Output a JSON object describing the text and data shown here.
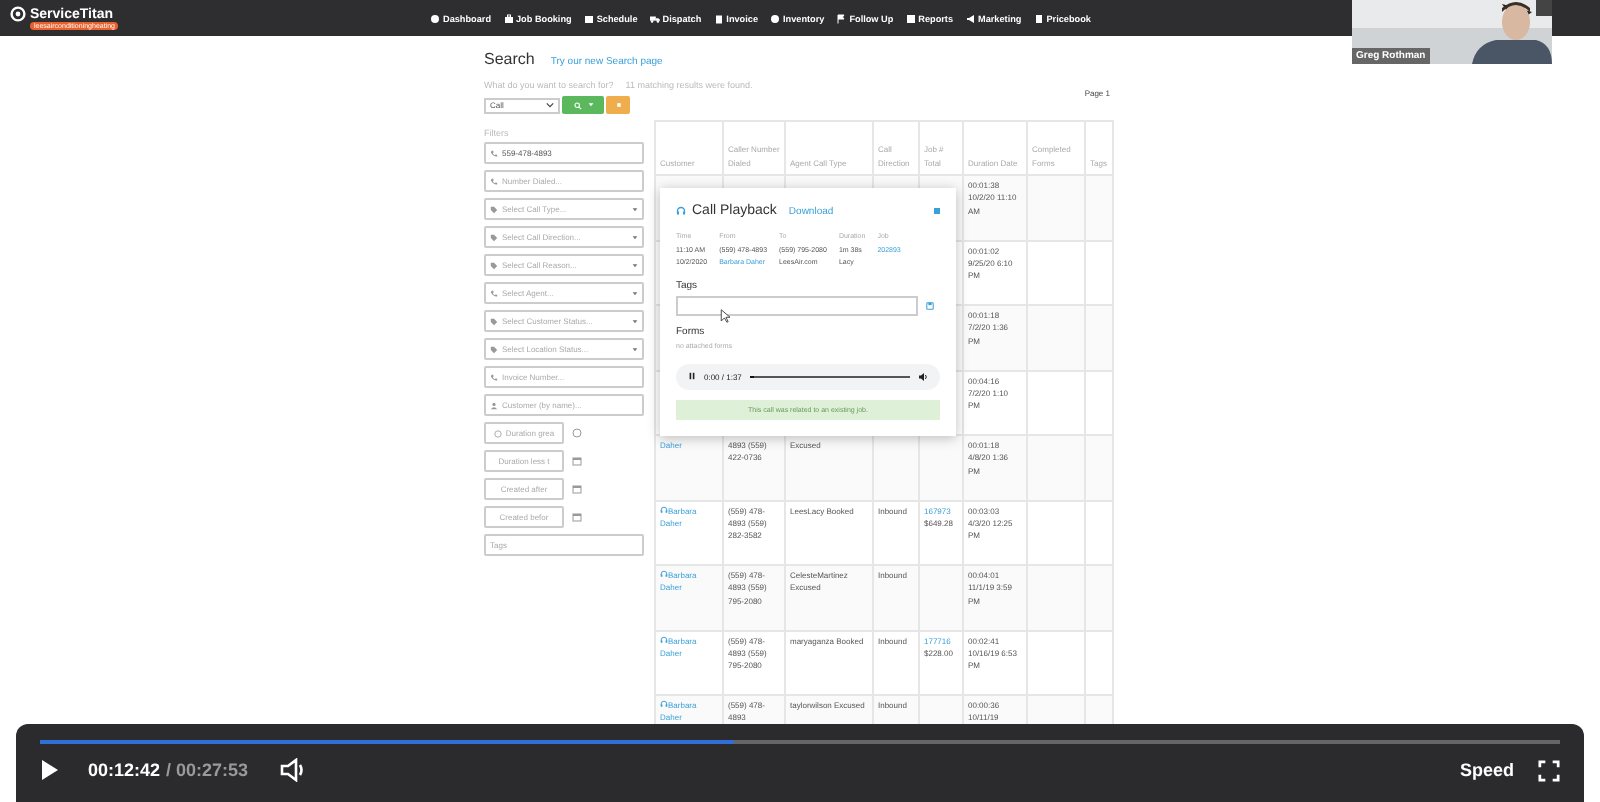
{
  "nav": {
    "logo": "ServiceTitan",
    "account": "leesairconditioningheating",
    "items": [
      {
        "label": "Dashboard"
      },
      {
        "label": "Job Booking"
      },
      {
        "label": "Schedule"
      },
      {
        "label": "Dispatch"
      },
      {
        "label": "Invoice"
      },
      {
        "label": "Inventory"
      },
      {
        "label": "Follow Up"
      },
      {
        "label": "Reports"
      },
      {
        "label": "Marketing"
      },
      {
        "label": "Pricebook"
      }
    ]
  },
  "webcam": {
    "name": "Greg Rothman"
  },
  "search": {
    "title": "Search",
    "new_page_link": "Try our new Search page",
    "prompt": "What do you want to search for?",
    "result_count": "11 matching results were found.",
    "type": "Call",
    "page": "Page 1"
  },
  "filters": {
    "label": "Filters",
    "fields": [
      {
        "kind": "text",
        "value": "559-478-4893"
      },
      {
        "kind": "text",
        "placeholder": "Number Dialed..."
      },
      {
        "kind": "select",
        "placeholder": "Select Call Type..."
      },
      {
        "kind": "select",
        "placeholder": "Select Call Direction..."
      },
      {
        "kind": "select",
        "placeholder": "Select Call Reason..."
      },
      {
        "kind": "select",
        "placeholder": "Select Agent..."
      },
      {
        "kind": "select",
        "placeholder": "Select Customer Status..."
      },
      {
        "kind": "select",
        "placeholder": "Select Location Status..."
      },
      {
        "kind": "text",
        "placeholder": "Invoice Number..."
      },
      {
        "kind": "text",
        "placeholder": "Customer (by name)..."
      },
      {
        "kind": "short",
        "placeholder": "Duration grea"
      },
      {
        "kind": "short",
        "placeholder": "Duration less t"
      },
      {
        "kind": "short",
        "placeholder": "Created after"
      },
      {
        "kind": "short",
        "placeholder": "Created befor"
      },
      {
        "kind": "text",
        "placeholder": "Tags"
      }
    ]
  },
  "table": {
    "columns": [
      "Customer",
      "Caller Number Dialed",
      "Agent Call Type",
      "Call Direction",
      "Job # Total",
      "Duration Date",
      "Completed Forms",
      "Tags"
    ],
    "rows": [
      {
        "duration": "00:01:38 10/2/20 11:10 AM"
      },
      {
        "duration": "00:01:02 9/25/20 6:10 PM"
      },
      {
        "duration": "00:01:18 7/2/20 1:36 PM"
      },
      {
        "duration": "00:04:16 7/2/20 1:10 PM"
      },
      {
        "customer": "Daher",
        "call_icon": false,
        "caller": "4893 (559) 422-0736",
        "agent": "Excused",
        "duration": "00:01:18 4/8/20 1:36 PM"
      },
      {
        "customer": "Barbara Daher",
        "call_icon": true,
        "caller": "(559) 478-4893 (559) 282-3582",
        "agent": "LeesLacy Booked",
        "direction": "Inbound",
        "job": "167973",
        "total": "$649.28",
        "duration": "00:03:03 4/3/20 12:25 PM"
      },
      {
        "customer": "Barbara Daher",
        "call_icon": true,
        "caller": "(559) 478-4893 (559) 795-2080",
        "agent": "CelesteMartinez Excused",
        "direction": "Inbound",
        "duration": "00:04:01 11/1/19 3:59 PM"
      },
      {
        "customer": "Barbara Daher",
        "call_icon": true,
        "caller": "(559) 478-4893 (559) 795-2080",
        "agent": "maryaganza Booked",
        "direction": "Inbound",
        "job": "177716",
        "total": "$228.00",
        "duration": "00:02:41 10/16/19 6:53 PM"
      },
      {
        "customer": "Barbara Daher",
        "call_icon": true,
        "caller": "(559) 478-4893",
        "agent": "taylorwilson Excused",
        "direction": "Inbound",
        "duration": "00:00:36 10/11/19"
      }
    ]
  },
  "modal": {
    "title": "Call Playback",
    "download": "Download",
    "info": [
      {
        "label": "Time",
        "lines": [
          "11:10 AM",
          "10/2/2020"
        ],
        "link": false
      },
      {
        "label": "From",
        "lines": [
          "(559) 478-4893",
          "Barbara Daher"
        ],
        "link": true
      },
      {
        "label": "To",
        "lines": [
          "(559) 795-2080",
          "LeesAir.com"
        ],
        "link": false
      },
      {
        "label": "Duration",
        "lines": [
          "1m 38s",
          "Lacy"
        ],
        "link": false
      },
      {
        "label": "Job",
        "lines": [
          "202893"
        ],
        "link": true
      }
    ],
    "tags_label": "Tags",
    "forms_label": "Forms",
    "forms_empty": "no attached forms",
    "player": {
      "time": "0:00 / 1:37",
      "level": 0.02
    },
    "notice": "This call was related to an existing job."
  },
  "video": {
    "elapsed": "00:12:42",
    "total": "/ 00:27:53",
    "level": 0.456,
    "speed": "Speed"
  }
}
